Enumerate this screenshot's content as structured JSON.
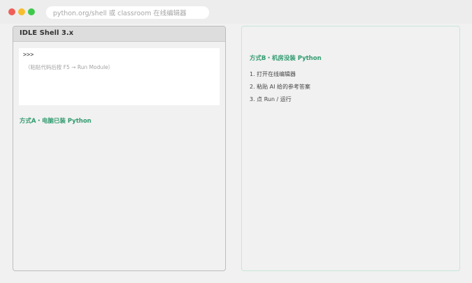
{
  "window": {
    "url": "python.org/shell 或 classroom 在线编辑器"
  },
  "idle": {
    "title": "IDLE Shell 3.x",
    "prompt": ">>>",
    "hint": "（粘贴代码后按 F5 → Run Module）"
  },
  "method_a": {
    "title": "方式A・电脑已装 Python"
  },
  "method_b": {
    "title": "方式B・机房没装 Python",
    "steps": [
      "1. 打开在线编辑器",
      "2. 粘贴 AI 给的参考答案",
      "3. 点 Run / 运行"
    ]
  },
  "colors": {
    "accent_green": "#2f9a6e",
    "right_border": "#c7e6d8"
  }
}
